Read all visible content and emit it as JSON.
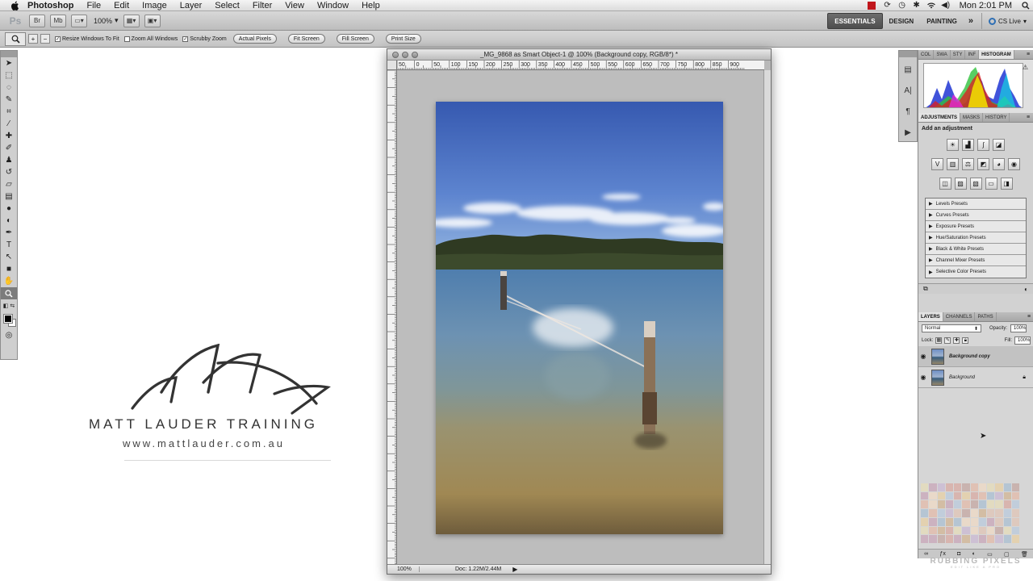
{
  "menubar": {
    "app": "Photoshop",
    "menus": [
      "File",
      "Edit",
      "Image",
      "Layer",
      "Select",
      "Filter",
      "View",
      "Window",
      "Help"
    ],
    "clock": "Mon 2:01 PM"
  },
  "appbar": {
    "logo": "Ps",
    "br": "Br",
    "mb": "Mb",
    "zoom": "100%",
    "workspaces": [
      "ESSENTIALS",
      "DESIGN",
      "PAINTING"
    ],
    "more": "»",
    "cslive": "CS Live"
  },
  "options": {
    "checks": [
      {
        "label": "Resize Windows To Fit",
        "checked": true
      },
      {
        "label": "Zoom All Windows",
        "checked": false
      },
      {
        "label": "Scrubby Zoom",
        "checked": true
      }
    ],
    "buttons": [
      "Actual Pixels",
      "Fit Screen",
      "Fill Screen",
      "Print Size"
    ]
  },
  "logo": {
    "title": "MATT LAUDER TRAINING",
    "url": "www.mattlauder.com.au"
  },
  "document": {
    "title": "_MG_9868 as Smart Object-1 @ 100% (Background copy, RGB/8*) *",
    "ruler_labels": [
      "50",
      "0",
      "50",
      "100",
      "150",
      "200",
      "250",
      "300",
      "350",
      "400",
      "450",
      "500",
      "550",
      "600",
      "650",
      "700",
      "750",
      "800",
      "850",
      "900"
    ],
    "zoom": "100%",
    "doc_info": "Doc: 1.22M/2.44M"
  },
  "panels": {
    "top_tabs": [
      "COL",
      "SWA",
      "STY",
      "INF",
      "HISTOGRAM"
    ],
    "adj_tabs": [
      "ADJUSTMENTS",
      "MASKS",
      "HISTORY"
    ],
    "adj_title": "Add an adjustment",
    "presets": [
      "Levels Presets",
      "Curves Presets",
      "Exposure Presets",
      "Hue/Saturation Presets",
      "Black & White Presets",
      "Channel Mixer Presets",
      "Selective Color Presets"
    ],
    "layer_tabs": [
      "LAYERS",
      "CHANNELS",
      "PATHS"
    ],
    "blend_mode": "Normal",
    "opacity_label": "Opacity:",
    "opacity": "100%",
    "lock_label": "Lock:",
    "fill_label": "Fill:",
    "fill": "100%",
    "layers": [
      {
        "name": "Background copy",
        "selected": true,
        "locked": false
      },
      {
        "name": "Background",
        "selected": false,
        "locked": true
      }
    ]
  },
  "watermark": {
    "title": "RUBBING PIXELS",
    "tagline": "EDIT LIKE A PRO"
  },
  "colors": {
    "accent_red": "#c0161c",
    "sky_top": "#3c63b4",
    "water": "#5f86a8",
    "sand": "#a48f5a"
  }
}
